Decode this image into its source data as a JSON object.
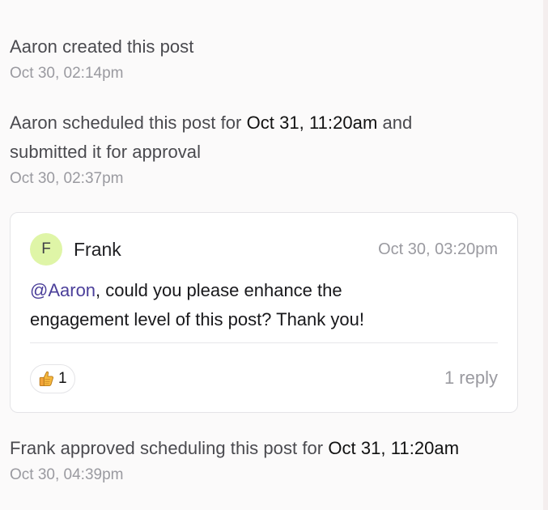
{
  "activity": {
    "created": {
      "text": "Aaron created this post",
      "time": "Oct 30, 02:14pm"
    },
    "scheduled": {
      "text_1": "Aaron scheduled this post for ",
      "date": "Oct 31, 11:20am",
      "text_2": " and",
      "text_3": "submitted it for approval",
      "time": "Oct 30, 02:37pm"
    },
    "comment": {
      "avatar_initial": "F",
      "author": "Frank",
      "time": "Oct 30, 03:20pm",
      "mention": "@Aaron",
      "text_line_1_rest": ", could you please enhance the",
      "text_line_2": "engagement level of this post? Thank you!",
      "reaction_icon": "thumbs-up-icon",
      "reaction_count": "1",
      "reply_label": "1 reply"
    },
    "approved": {
      "text_1": "Frank approved scheduling this post for ",
      "date": "Oct 31, 11:20am",
      "time": "Oct 30, 04:39pm"
    }
  },
  "colors": {
    "avatar_background": "#dff5a7",
    "mention": "#4b3f9a",
    "muted_text": "#9a9aa0",
    "card_border": "#e4e4e7"
  }
}
